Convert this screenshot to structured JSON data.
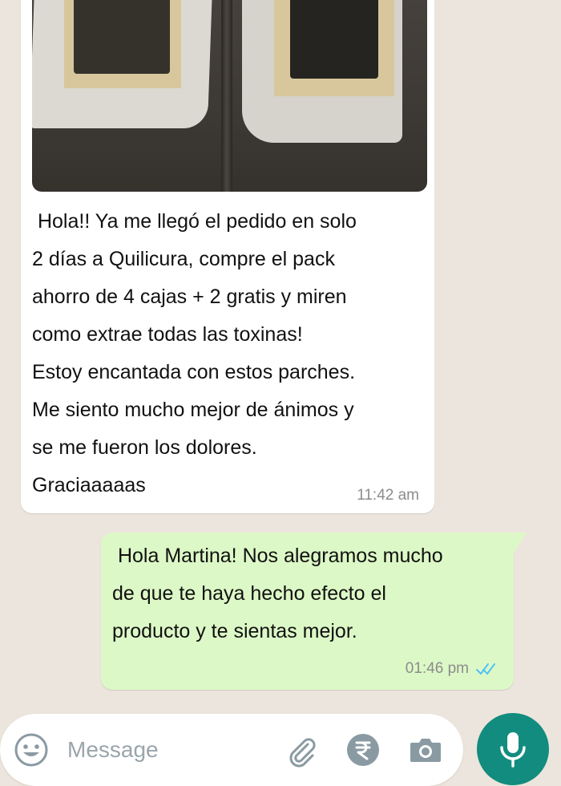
{
  "incoming_message": {
    "text": " Hola!! Ya me llegó el pedido en solo\n2 días a Quilicura, compre el pack\nahorro de 4 cajas + 2 gratis y miren\ncomo extrae todas las toxinas!\nEstoy encantada con estos parches.\nMe siento mucho mejor de ánimos y\nse me fueron los dolores.\nGraciaaaaas",
    "time": "11:42 am",
    "has_photo": true
  },
  "outgoing_message": {
    "text": " Hola Martina! Nos alegramos mucho\nde que te haya hecho efecto el\nproducto y te sientas mejor.",
    "time": "01:46 pm",
    "status": "read",
    "tick_color": "#4fc3f7"
  },
  "composer": {
    "placeholder": "Message",
    "icons": [
      "emoji-icon",
      "attach-icon",
      "rupee-payment-icon",
      "camera-icon",
      "mic-icon"
    ]
  },
  "colors": {
    "chat_background": "#ece5dd",
    "incoming_bubble": "#ffffff",
    "outgoing_bubble": "#dcf8c6",
    "accent": "#128c7e",
    "icon_gray": "#8a9aa2"
  }
}
